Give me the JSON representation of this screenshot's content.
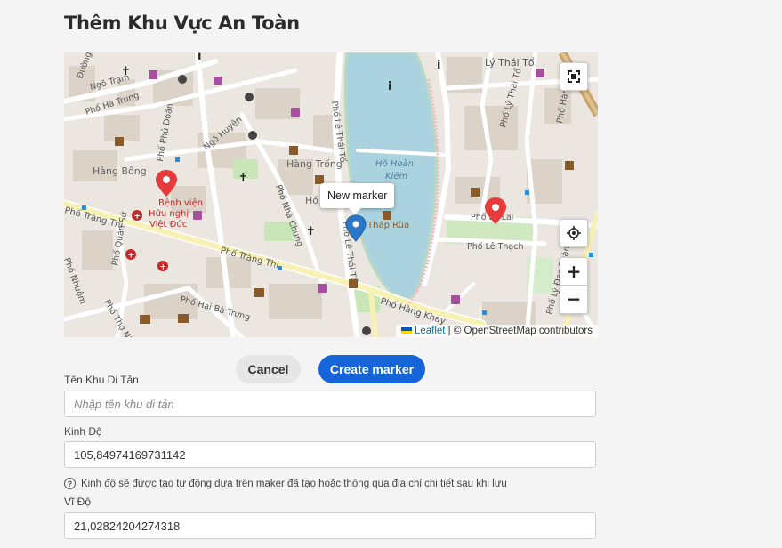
{
  "page": {
    "title": "Thêm Khu Vực An Toàn"
  },
  "map": {
    "popup_text": "New marker",
    "attribution_link": "Leaflet",
    "attribution_text": "| © OpenStreetMap contributors",
    "labels": {
      "ly_thai_to": "Lý Thái Tổ",
      "ngo_tram": "Ngõ Trạm",
      "pho_ha_trung": "Phố Hà Trung",
      "hang_bong": "Hàng Bông",
      "hang_trong": "Hàng Trống",
      "ho_hoan_kiem_1": "Hồ Hoàn",
      "ho_hoan_kiem_2": "Kiếm",
      "thap_rua": "Tháp Rùa",
      "benh_vien_1": "Bệnh viện",
      "benh_vien_2": "Hữu nghị",
      "benh_vien_3": "Việt Đức",
      "pho_trang_thi_1": "Phố Tràng Thi",
      "pho_trang_thi_2": "Phố Tràng Thi",
      "pho_hai_ba_trung": "Phố Hai Bà Trưng",
      "pho_hang_khay": "Phố Hàng Khay",
      "pho_le_lai": "Phố Lê Lai",
      "pho_le_thach": "Phố Lê Thạch",
      "pho_ly_thai_to": "Phố Lý Thái Tổ",
      "pho_le_thai_to_1": "Phố Lê Thái Tổ",
      "pho_le_thai_to_2": "Phố Lê Thái Tổ",
      "pho_phu_doan": "Phố Phủ Doãn",
      "ngo_huyen": "Ngõ Huyện",
      "pho_nha_chung": "Phố Nhà Chung",
      "pho_quan_su": "Phố Quán Sứ",
      "pho_hang_voi": "Phố Hàng Vôi",
      "pho_ly_dao_thanh": "Phố Lý Đạo Thành",
      "pho_tho_nhuom": "Phố Thợ Nhuộm",
      "pho_tho_nhuom_2": "Phố Thợ Nhuộm",
      "duong_thanh": "Đường Thành",
      "ho_partial": "Hồ",
      "pho_nhuom_left": "Phố Nhuộm"
    }
  },
  "actions": {
    "cancel": "Cancel",
    "create": "Create marker"
  },
  "form": {
    "name_label": "Tên Khu Di Tản",
    "name_placeholder": "Nhập tên khu di tản",
    "longitude_label": "Kinh Độ",
    "longitude_value": "105,84974169731142",
    "longitude_hint": "Kinh độ sẽ được tạo tự động dựa trên maker đã tạo hoặc thông qua địa chỉ chi tiết sau khi lưu",
    "latitude_label": "Vĩ Độ",
    "latitude_value": "21,02824204274318"
  }
}
